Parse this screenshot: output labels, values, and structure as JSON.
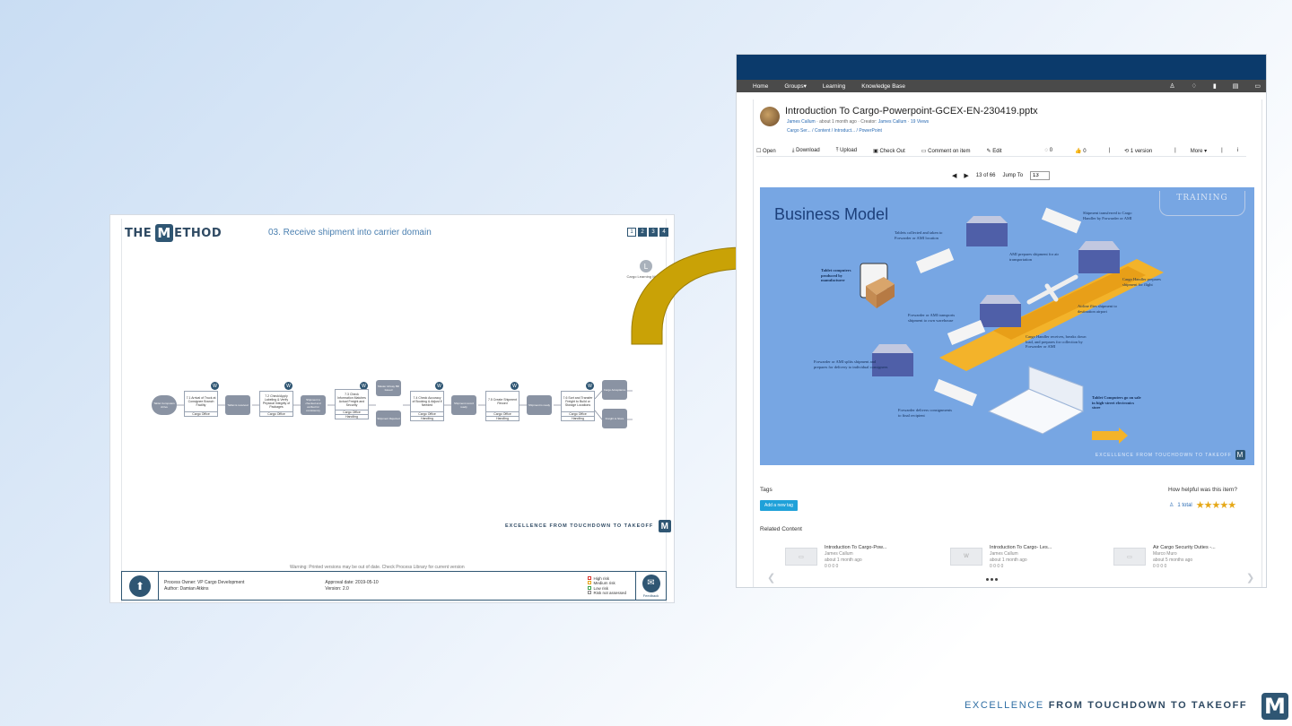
{
  "method": {
    "logo_pre": "THE",
    "logo_m": "M",
    "logo_post": "ETHOD",
    "title": "03. Receive shipment into carrier domain",
    "steps": [
      "1",
      "2",
      "3",
      "4"
    ],
    "library_label": "Cargo Learning Material",
    "library_letter": "L",
    "flow": {
      "start": "Tablet Computers Arrive",
      "boxes": [
        {
          "text": "7.1 Arrival of Truck at Consignee Branch Facility",
          "role": "Cargo Office",
          "role2": ""
        },
        {
          "text": "7.2 Check/Apply Labeling & Verify Physical Integrity of Packages",
          "role": "Cargo Office",
          "role2": ""
        },
        {
          "text": "7.3 Check Information Matches Actual Freight and Security",
          "role": "Cargo Office",
          "role2": "Handling"
        },
        {
          "text": "7.4 Check Accuracy of Booking & Adjust if Needed",
          "role": "Cargo Office",
          "role2": "Handling"
        },
        {
          "text": "7.5 Create Shipment Record",
          "role": "Cargo Office",
          "role2": "Handling"
        },
        {
          "text": "7.6 Sort and Transfer Freight to Build or Storage Locations",
          "role": "Cargo Office",
          "role2": "Handling"
        }
      ],
      "greys": [
        "Tablet is received",
        "Shipment is checked and verified for consistency",
        "Shipment record ready",
        "Shipment is ready",
        "Shipment in the system"
      ],
      "side_top": "Master Airway Bill Issued",
      "side_bottom": "Shipment Rejected",
      "end_top": "Cargo Acceptance",
      "end_bottom": "Freight to Store",
      "w": "W"
    },
    "slogan": "EXCELLENCE FROM TOUCHDOWN TO TAKEOFF",
    "slogan_logo": "M",
    "warning": "Warning: Printed versions may be out of date. Check Process Library for current version",
    "footer": {
      "owner": "Process Owner: VP Cargo Development",
      "author": "Author: Damian Atkins",
      "approval": "Approval date: 2019-05-10",
      "version": "Version: 2.0",
      "risks": [
        "High risk",
        "Medium risk",
        "Low risk",
        "Risk not assessed"
      ],
      "risk_colors": [
        "#d9342b",
        "#e8a317",
        "#3aa14b",
        "#888888"
      ],
      "feedback": "Feedback"
    }
  },
  "kb": {
    "nav": [
      "Home",
      "Groups▾",
      "Learning",
      "Knowledge Base"
    ],
    "nav_icons": [
      "person-icon",
      "lightbulb-icon",
      "bookmark-icon",
      "clipboard-icon",
      "chat-icon"
    ],
    "title": "Introduction To Cargo-Powerpoint-GCEX-EN-230419.pptx",
    "meta_author": "James Callum",
    "meta_time": "about 1 month ago",
    "meta_creator_label": "Creator:",
    "meta_creator": "James Callum",
    "meta_views": "19 Views",
    "breadcrumb": "Cargo Ser... / Content / Introduct... / PowerPoint",
    "toolbar": [
      "Open",
      "Download",
      "Upload",
      "Check Out",
      "Comment on item",
      "Edit"
    ],
    "toolbar_right": [
      "0",
      "0",
      "|",
      "1 version",
      "|",
      "More ▾",
      "|",
      "i"
    ],
    "pager_page": "13 of 66",
    "jump_label": "Jump To",
    "jump_value": "13",
    "slide": {
      "title": "Business Model",
      "badge": "TRAINING",
      "notes": [
        "Tablet computers produced by manufacturer",
        "Tablets collected and taken to Forwarder or AMI location",
        "Shipment transferred to Cargo Handler by Forwarder or AMI",
        "AMI prepares shipment for air transportation",
        "Cargo Handler prepares shipment for flight",
        "Forwarder or AMI transports shipment to own warehouse",
        "Airline flies shipment to destination airport",
        "Cargo Handler receives, breaks down load, and prepares for collection by Forwarder or AMI",
        "Forwarder or AMI splits shipment and prepares for delivery to individual consignees",
        "Forwarder delivers consignments to final recipient",
        "Tablet Computers go on sale in high-street electronics store"
      ],
      "slogan": "EXCELLENCE FROM TOUCHDOWN TO TAKEOFF",
      "logo": "M",
      "ami": "AMI"
    },
    "tags_label": "Tags",
    "add_tag": "Add a new tag",
    "helpful_label": "How helpful was this item?",
    "rating_total": "1 total",
    "rating_stars": "★★★★★",
    "related_label": "Related Content",
    "related": [
      {
        "title": "Introduction To Cargo-Pow...",
        "author": "James Callum",
        "time": "about 1 month ago",
        "stats": "0 0 0 0"
      },
      {
        "title": "Introduction To Cargo- Les...",
        "author": "James Callum",
        "time": "about 1 month ago",
        "stats": "0 0 0 0"
      },
      {
        "title": "Air Cargo Security Duties -...",
        "author": "Marco Muro",
        "time": "about 5 months ago",
        "stats": "0 0 0 0"
      }
    ]
  },
  "footer_slogan_lite": "EXCELLENCE",
  "footer_slogan_strong": "FROM TOUCHDOWN TO TAKEOFF",
  "footer_logo": "M",
  "colors": {
    "brand": "#2f5673",
    "header": "#0b3a6b",
    "arrow": "#c9a206",
    "slide_bg": "#77a6e3"
  }
}
